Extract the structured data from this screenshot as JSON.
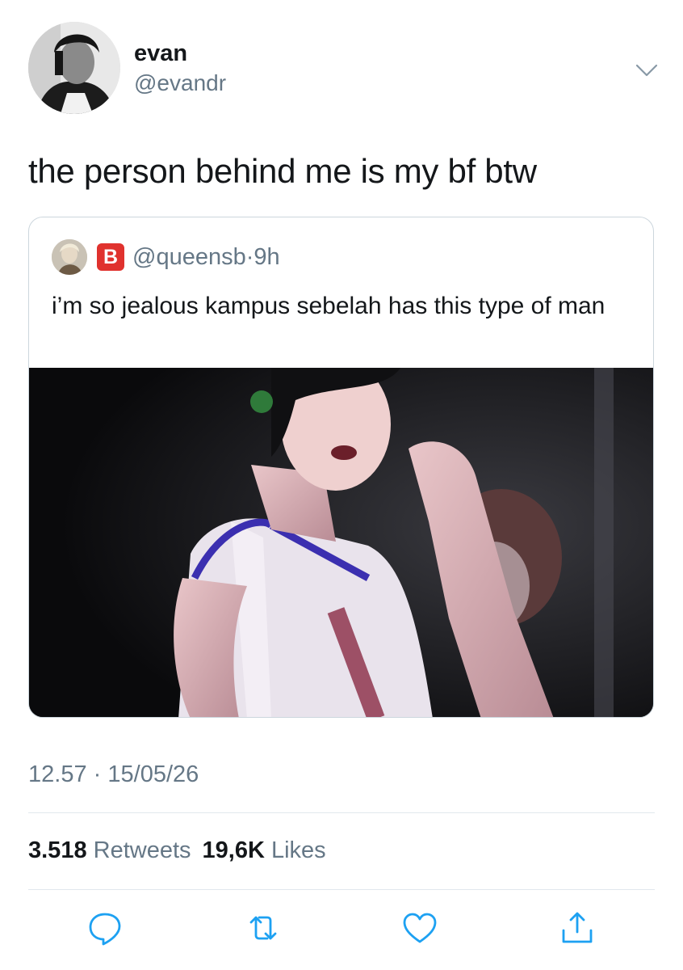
{
  "author": {
    "display_name": "evan",
    "handle": "@evandr",
    "avatar_icon": "profile-photo"
  },
  "tweet": {
    "text": "the person behind me is my bf btw"
  },
  "quoted_tweet": {
    "badge": "B",
    "handle": "@queensb",
    "time": "9h",
    "separator": "·",
    "text": "i’m so jealous kampus sebelah has this type of man",
    "photo_icon": "photo"
  },
  "meta": {
    "time": "12.57",
    "separator": "·",
    "date": "15/05/26"
  },
  "stats": {
    "retweets_count": "3.518",
    "retweets_label": "Retweets",
    "likes_count": "19,6K",
    "likes_label": "Likes"
  },
  "actions": [
    "reply-icon",
    "retweet-icon",
    "like-icon",
    "share-icon"
  ],
  "colors": {
    "text": "#14171a",
    "secondary": "#657786",
    "border": "#ccd6dd",
    "badge": "#e0322e",
    "action_icon": "#1da1f2"
  }
}
